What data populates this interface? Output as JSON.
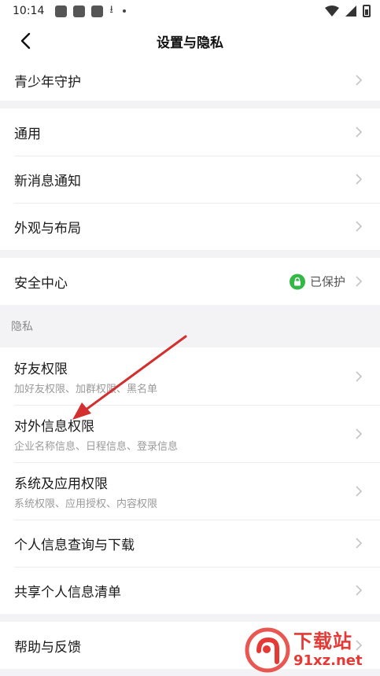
{
  "status_bar": {
    "time": "10:14"
  },
  "nav": {
    "title": "设置与隐私"
  },
  "groups": {
    "teen": {
      "label": "青少年守护"
    },
    "general": [
      {
        "label": "通用"
      },
      {
        "label": "新消息通知"
      },
      {
        "label": "外观与布局"
      }
    ],
    "security": {
      "label": "安全中心",
      "status": "已保护"
    }
  },
  "privacy": {
    "header": "隐私",
    "items": [
      {
        "label": "好友权限",
        "sub": "加好友权限、加群权限、黑名单"
      },
      {
        "label": "对外信息权限",
        "sub": "企业名称信息、日程信息、登录信息"
      },
      {
        "label": "系统及应用权限",
        "sub": "系统权限、应用授权、内容权限"
      },
      {
        "label": "个人信息查询与下载",
        "sub": ""
      },
      {
        "label": "共享个人信息清单",
        "sub": ""
      }
    ]
  },
  "help": {
    "label": "帮助与反馈"
  },
  "watermark": {
    "brand": "下载站",
    "url": "91xz.net"
  },
  "colors": {
    "accent_green": "#31b845",
    "annotation_red": "#d32f2f",
    "watermark_red": "#e53935"
  }
}
